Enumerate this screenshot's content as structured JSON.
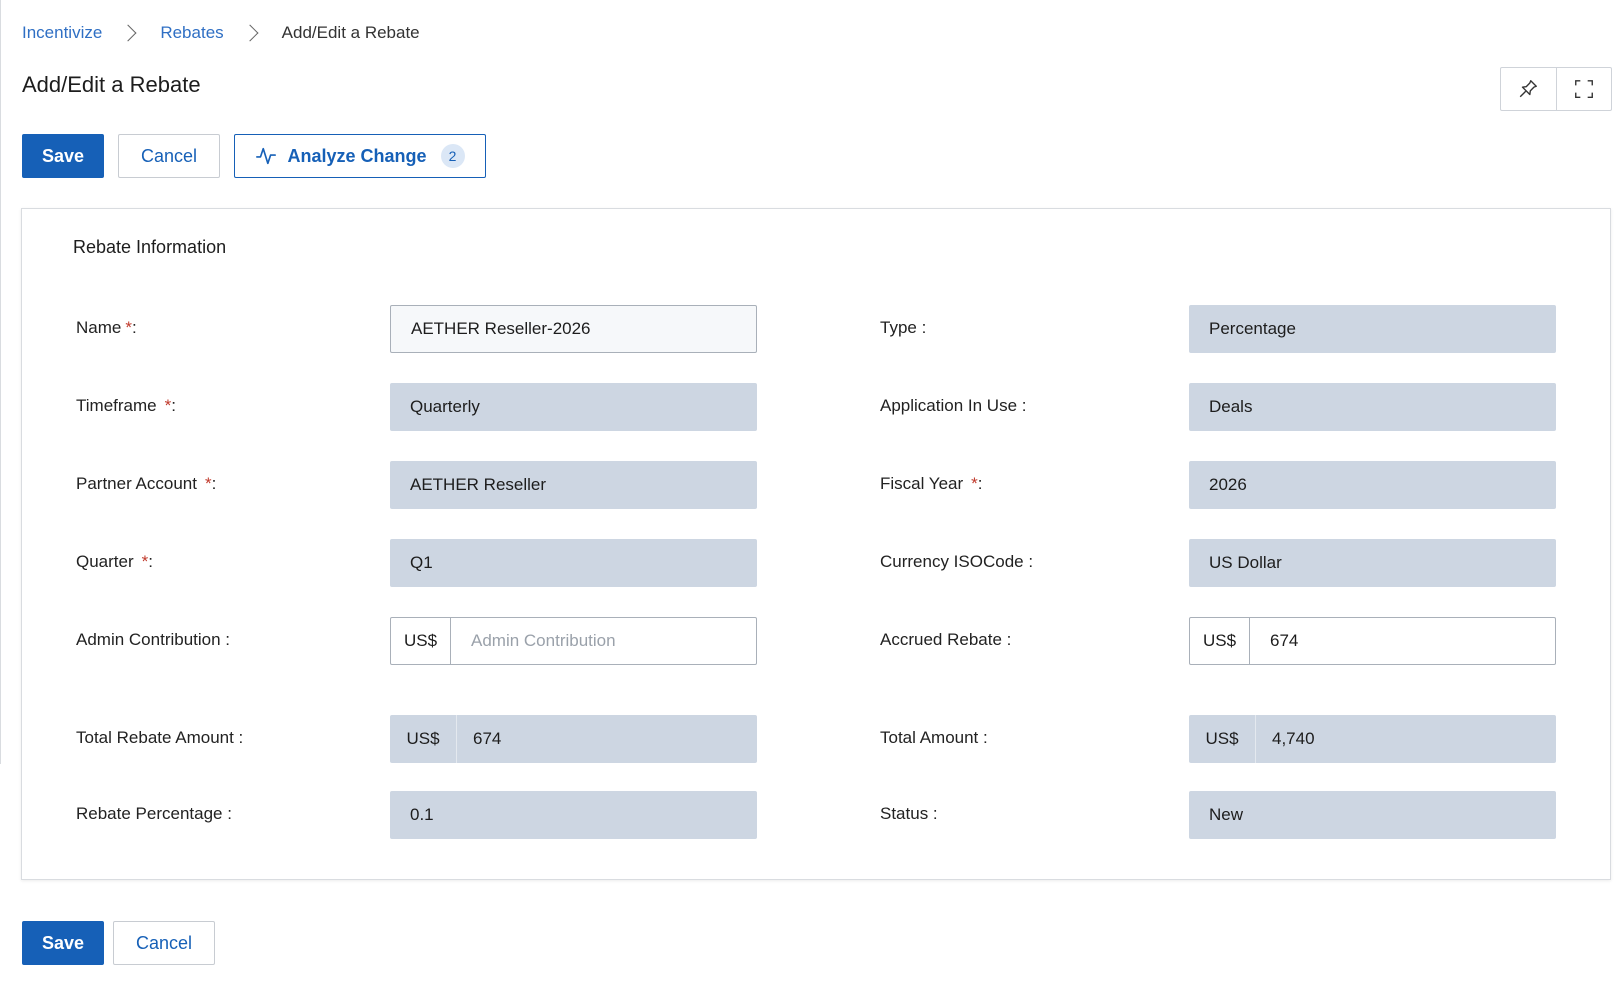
{
  "breadcrumb": {
    "items": [
      {
        "label": "Incentivize"
      },
      {
        "label": "Rebates"
      },
      {
        "label": "Add/Edit a Rebate"
      }
    ]
  },
  "page": {
    "title": "Add/Edit a Rebate"
  },
  "toolbar": {
    "save_label": "Save",
    "cancel_label": "Cancel",
    "analyze_label": "Analyze Change",
    "analyze_count": "2"
  },
  "icons": {
    "pin": "pin-icon",
    "expand": "expand-icon",
    "analyze": "activity-icon"
  },
  "section": {
    "title": "Rebate Information"
  },
  "form": {
    "name": {
      "label": "Name",
      "required_mark": "*",
      "suffix": ":",
      "value": "AETHER Reseller-2026"
    },
    "type": {
      "label": "Type :",
      "value": "Percentage"
    },
    "timeframe": {
      "label": "Timeframe",
      "required_mark": "*",
      "suffix": ":",
      "value": "Quarterly"
    },
    "application": {
      "label": "Application In Use :",
      "value": "Deals"
    },
    "partner_account": {
      "label": "Partner Account",
      "required_mark": "*",
      "suffix": ":",
      "value": "AETHER Reseller"
    },
    "fiscal_year": {
      "label": "Fiscal Year",
      "required_mark": "*",
      "suffix": ":",
      "value": "2026"
    },
    "quarter": {
      "label": "Quarter",
      "required_mark": "*",
      "suffix": ":",
      "value": "Q1"
    },
    "currency": {
      "label": "Currency ISOCode :",
      "value": "US Dollar"
    },
    "admin_contribution": {
      "label": "Admin Contribution :",
      "prefix": "US$",
      "value": "",
      "placeholder": "Admin Contribution"
    },
    "accrued_rebate": {
      "label": "Accrued Rebate :",
      "prefix": "US$",
      "value": "674"
    },
    "total_rebate_amount": {
      "label": "Total Rebate Amount :",
      "prefix": "US$",
      "value": "674"
    },
    "total_amount": {
      "label": "Total Amount :",
      "prefix": "US$",
      "value": "4,740"
    },
    "rebate_percentage": {
      "label": "Rebate Percentage :",
      "value": "0.1"
    },
    "status": {
      "label": "Status :",
      "value": "New"
    }
  },
  "footer": {
    "save_label": "Save",
    "cancel_label": "Cancel"
  },
  "colors": {
    "primary": "#1660b7",
    "readonly_bg": "#cdd6e2",
    "required": "#c0392b",
    "link": "#2f6fc4"
  }
}
